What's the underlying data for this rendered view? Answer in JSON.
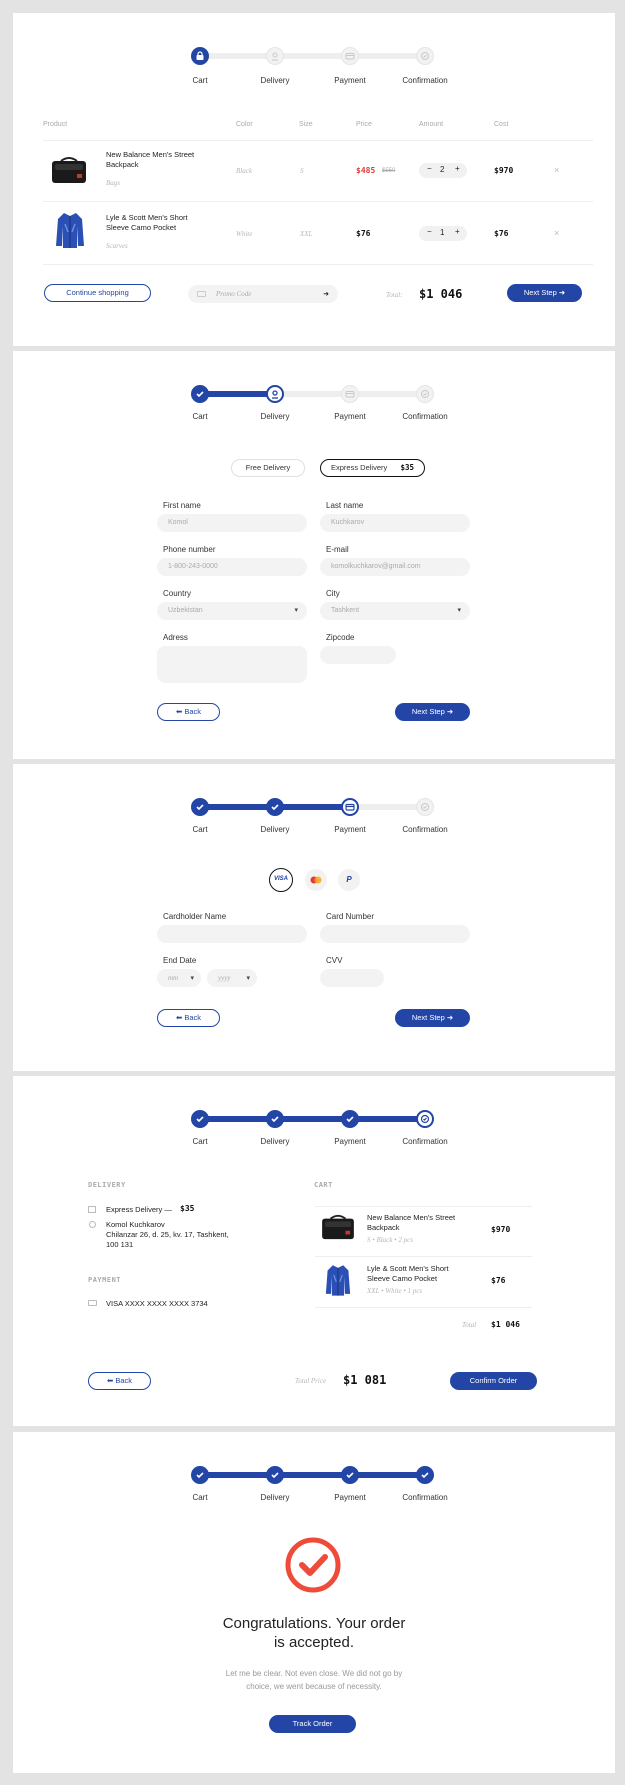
{
  "steps": [
    "Cart",
    "Delivery",
    "Payment",
    "Confirmation"
  ],
  "cart": {
    "headers": [
      "Product",
      "Color",
      "Size",
      "Price",
      "Amount",
      "Cost"
    ],
    "items": [
      {
        "name": "New Balance Men's Street Backpack",
        "category": "Bags",
        "color": "Black",
        "size": "S",
        "price": "$485",
        "old_price": "$550",
        "qty": "2",
        "cost": "$970"
      },
      {
        "name": "Lyle & Scott Men's Short Sleeve Camo Pocket",
        "category": "Scarves",
        "color": "White",
        "size": "XXL",
        "price": "$76",
        "qty": "1",
        "cost": "$76"
      }
    ],
    "continue_label": "Continue shopping",
    "promo_placeholder": "Promo Code",
    "total_label": "Total:",
    "total_value": "$1 046",
    "next_label": "Next Step"
  },
  "delivery": {
    "options": [
      {
        "label": "Free Delivery"
      },
      {
        "label": "Express Delivery",
        "price": "$35"
      }
    ],
    "first_name_label": "First name",
    "first_name_value": "Komol",
    "last_name_label": "Last name",
    "last_name_value": "Kuchkarov",
    "phone_label": "Phone number",
    "phone_value": "1-800-243-0000",
    "email_label": "E-mail",
    "email_value": "komolkuchkarov@gmail.com",
    "country_label": "Country",
    "country_value": "Uzbekistan",
    "city_label": "City",
    "city_value": "Tashkent",
    "address_label": "Adress",
    "zip_label": "Zipcode",
    "back_label": "Back",
    "next_label": "Next Step"
  },
  "payment": {
    "methods": [
      "VISA",
      "mastercard-icon",
      "paypal-icon"
    ],
    "cardholder_label": "Cardholder Name",
    "card_number_label": "Card Number",
    "end_date_label": "End Date",
    "month_placeholder": "mm",
    "year_placeholder": "yyyy",
    "cvv_label": "CVV",
    "back_label": "Back",
    "next_label": "Next Step"
  },
  "confirmation": {
    "delivery_title": "DELIVERY",
    "delivery_method": "Express Delivery —",
    "delivery_price": "$35",
    "name": "Komol Kuchkarov",
    "address": "Chilanzar 26, d. 25, kv. 17, Tashkent, 100 131",
    "payment_title": "PAYMENT",
    "card": "VISA XXXX XXXX XXXX 3734",
    "cart_title": "CART",
    "items": [
      {
        "name": "New Balance Men's Street Backpack",
        "meta": "S • Black • 2 pcs",
        "cost": "$970"
      },
      {
        "name": "Lyle & Scott Men's Short Sleeve Camo Pocket",
        "meta": "XXL • White • 1 pcs",
        "cost": "$76"
      }
    ],
    "subtotal_label": "Total",
    "subtotal_value": "$1 046",
    "back_label": "Back",
    "total_price_label": "Total Price",
    "total_price_value": "$1 081",
    "confirm_label": "Confirm Order"
  },
  "success": {
    "title_line1": "Congratulations. Your order",
    "title_line2": "is accepted.",
    "text_line1": "Let me be clear. Not even close. We did not go by",
    "text_line2": "choice, we went because of necessity.",
    "track_label": "Track Order"
  },
  "colors": {
    "accent": "#2346a6",
    "sale": "#e53935",
    "success_icon": "#ef4b3a"
  }
}
